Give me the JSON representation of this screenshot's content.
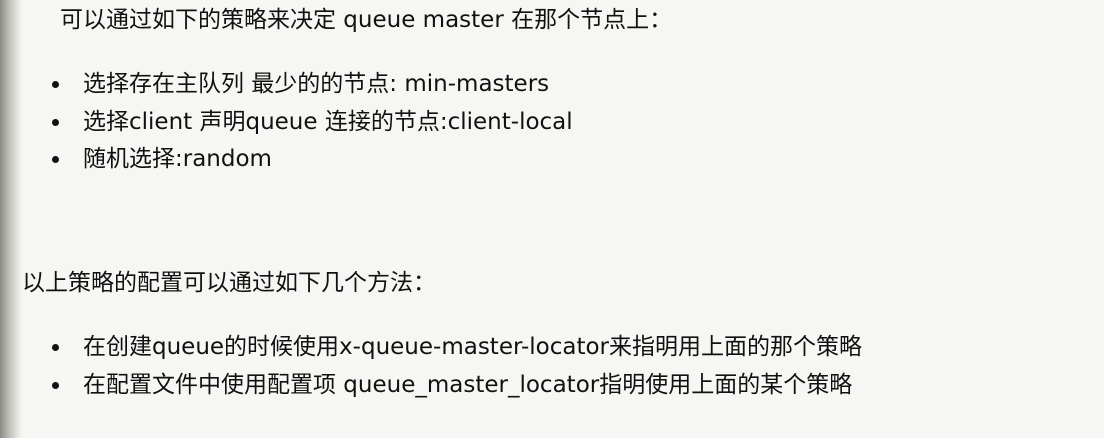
{
  "paragraph_1": "可以通过如下的策略来决定 queue master 在那个节点上：",
  "strategies": [
    "选择存在主队列 最少的的节点: min-masters",
    "选择client 声明queue 连接的节点:client-local",
    "随机选择:random"
  ],
  "paragraph_2": "以上策略的配置可以通过如下几个方法：",
  "methods": [
    "在创建queue的时候使用x-queue-master-locator来指明用上面的那个策略",
    "在配置文件中使用配置项 queue_master_locator指明使用上面的某个策略"
  ]
}
